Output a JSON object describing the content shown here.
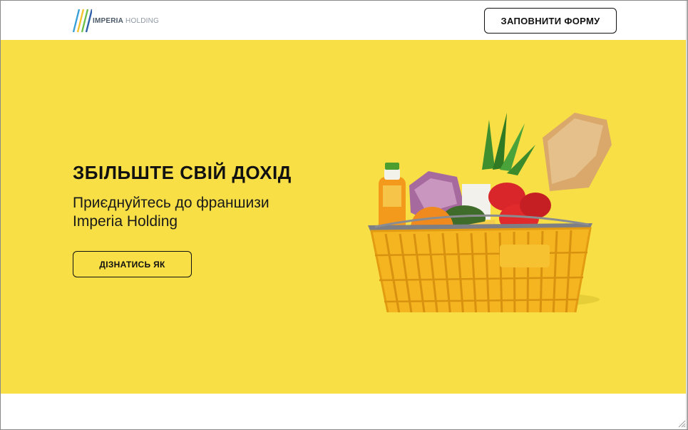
{
  "header": {
    "logo": {
      "brand_bold": "IMPERIA",
      "brand_light": " HOLDING"
    },
    "form_button_label": "ЗАПОВНИТИ ФОРМУ"
  },
  "hero": {
    "title": "ЗБІЛЬШТЕ СВІЙ ДОХІД",
    "subtitle": "Приєднуйтесь до франшизи Imperia Holding",
    "cta_label": "ДІЗНАТИСЬ ЯК",
    "image_icon": "grocery-basket"
  },
  "colors": {
    "hero_background": "#f7df45",
    "button_border": "#111111",
    "basket": "#f4b520"
  }
}
